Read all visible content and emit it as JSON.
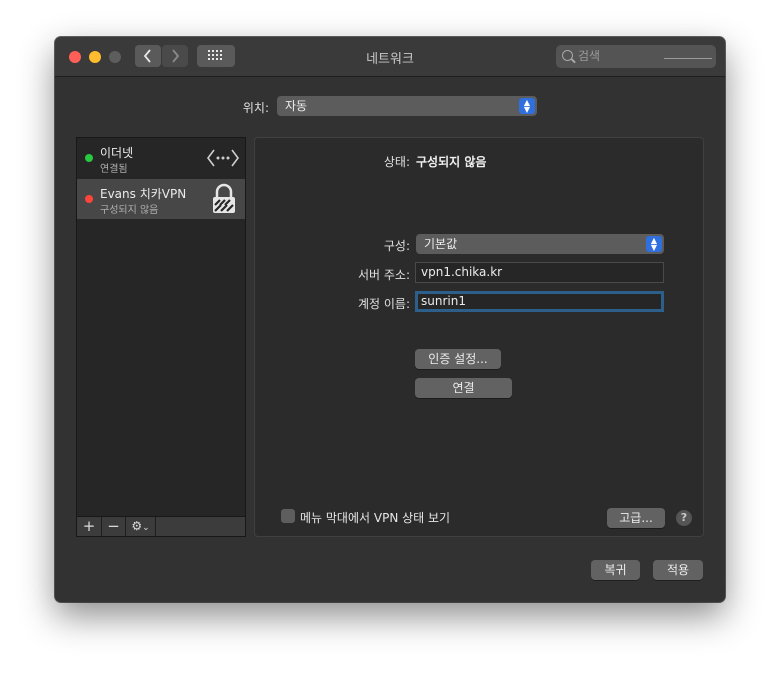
{
  "window": {
    "title": "네트워크"
  },
  "search": {
    "placeholder": "검색"
  },
  "location": {
    "label": "위치:",
    "value": "자동"
  },
  "services": [
    {
      "name": "이더넷",
      "status": "연결됨",
      "status_color": "#28c840",
      "icon": "ethernet-arrows-icon"
    },
    {
      "name": "Evans 치카VPN",
      "status": "구성되지 않음",
      "status_color": "#ff453a",
      "icon": "vpn-lock-icon"
    }
  ],
  "sidebar_toolbar": {
    "add": "+",
    "remove": "−",
    "gear": "gear-icon"
  },
  "detail": {
    "status_label": "상태:",
    "status_value": "구성되지 않음",
    "config_label": "구성:",
    "config_value": "기본값",
    "server_label": "서버 주소:",
    "server_value": "vpn1.chika.kr",
    "account_label": "계정 이름:",
    "account_value": "sunrin1",
    "auth_button": "인증 설정...",
    "connect_button": "연결",
    "menu_checkbox_label": "메뉴 막대에서 VPN 상태 보기",
    "menu_checkbox_checked": false,
    "advanced_button": "고급...",
    "help_button": "?"
  },
  "footer": {
    "revert_button": "복귀",
    "apply_button": "적용"
  },
  "colors": {
    "accent": "#2f6fde",
    "focus_ring": "#2c5f8a"
  }
}
